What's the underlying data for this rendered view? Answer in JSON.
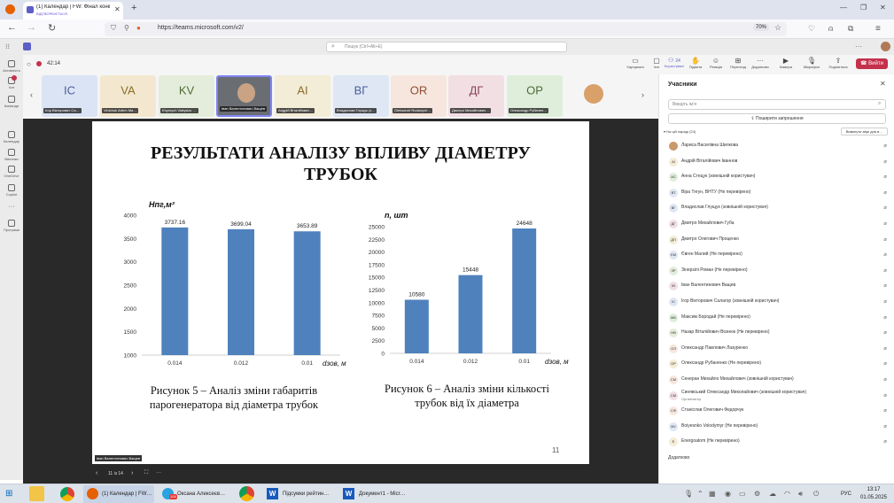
{
  "browser": {
    "tab_title": "(1) Календар | FW: Фінал конк",
    "tab_sub": "ВІДТВОРЮЄТЬСЯ",
    "url": "https://teams.microsoft.com/v2/",
    "zoom": "70%",
    "new_tab": "+"
  },
  "teams": {
    "search_placeholder": "Пошук (Ctrl+Alt+E)",
    "rail": [
      {
        "label": "Активність"
      },
      {
        "label": "Чат"
      },
      {
        "label": "Команди"
      },
      {
        "label": "Календар"
      },
      {
        "label": "Виклики"
      },
      {
        "label": "OneDrive"
      },
      {
        "label": "Copilot"
      },
      {
        "label": "Програми"
      }
    ],
    "timer": "42:14",
    "toolbar": [
      {
        "label": "Чат",
        "icon": "chat-icon"
      },
      {
        "label": "Користувачі",
        "icon": "people-icon",
        "count": "24"
      },
      {
        "label": "Підняти",
        "icon": "raise-hand-icon"
      },
      {
        "label": "Реакція",
        "icon": "react-icon"
      },
      {
        "label": "Перегляд",
        "icon": "view-icon"
      },
      {
        "label": "Додатково",
        "icon": "more-icon"
      }
    ],
    "toolbar_extra": [
      {
        "label": "Камера",
        "icon": "camera-icon"
      },
      {
        "label": "Мікрофон",
        "icon": "mic-icon"
      },
      {
        "label": "Поділитися",
        "icon": "share-icon"
      }
    ],
    "leave_button": "Вийти",
    "share_left_label": "Харчувати"
  },
  "tiles": [
    {
      "initials": "ІС",
      "name": "Ігор Вікторович Са…",
      "color": "#dbe4f5",
      "text": "#4a5d9a"
    },
    {
      "initials": "VA",
      "name": "Vinichuk Artem Ma…",
      "color": "#f3e8cf",
      "text": "#8a6d2a"
    },
    {
      "initials": "KV",
      "name": "Khymych Viatyslav …",
      "color": "#e4eddb",
      "text": "#4f6b38"
    },
    {
      "initials": "",
      "name": "Іван Валентинович Ващев",
      "color": "#6a6e73",
      "text": "#fff"
    },
    {
      "initials": "AI",
      "name": "Андрій Віталійович…",
      "color": "#f3ecd6",
      "text": "#8a6d2a"
    },
    {
      "initials": "ВГ",
      "name": "Владислав Глущук (з…",
      "color": "#dfe7f4",
      "text": "#4a5d9a"
    },
    {
      "initials": "OR",
      "name": "Oleksandr Rudanych…",
      "color": "#f6e6de",
      "text": "#8e4f35"
    },
    {
      "initials": "ДГ",
      "name": "Дмитро Михайлович…",
      "color": "#f1dfe4",
      "text": "#8a3f55"
    },
    {
      "initials": "OP",
      "name": "Олександр Рубанен…",
      "color": "#dfeedb",
      "text": "#4f6b38"
    },
    {
      "initials": "",
      "name": "",
      "color": "#f5f5f5",
      "text": "#fff"
    }
  ],
  "slide": {
    "title_line1": "РЕЗУЛЬТАТИ АНАЛІЗУ ВПЛИВУ ДІАМЕТРУ",
    "title_line2": "ТРУБОК",
    "caption1_line1": "Рисунок 5 – Аналіз зміни габаритів",
    "caption1_line2": "парогенератора від діаметра трубок",
    "caption2_line1": "Рисунок 6 – Аналіз зміни кількості",
    "caption2_line2": "трубок від їх діаметра",
    "page_number": "11",
    "presenter_label": "Іван Валентинович Ващев"
  },
  "chart_data": [
    {
      "type": "bar",
      "ylabel_html": "H",
      "ylabel": "Hпг,м²",
      "xlabel": "dзов, м",
      "categories": [
        "0.014",
        "0.012",
        "0.01"
      ],
      "values": [
        3737.16,
        3699.04,
        3653.89
      ],
      "data_labels": [
        "3737.16",
        "3699.04",
        "3653.89"
      ],
      "ylim": [
        1000,
        4000
      ],
      "yticks": [
        "1000",
        "1500",
        "2000",
        "2500",
        "3000",
        "3500",
        "4000"
      ],
      "color": "#4f81bd"
    },
    {
      "type": "bar",
      "ylabel": "n, шт",
      "xlabel": "dзов, м",
      "categories": [
        "0.014",
        "0.012",
        "0.01"
      ],
      "values": [
        10580,
        15448,
        24648
      ],
      "data_labels": [
        "10580",
        "15448",
        "24648"
      ],
      "ylim": [
        0,
        25000
      ],
      "yticks": [
        "0",
        "2500",
        "5000",
        "7500",
        "10000",
        "12500",
        "15000",
        "17500",
        "20000",
        "22500",
        "25000"
      ],
      "color": "#4f81bd"
    }
  ],
  "slide_nav": {
    "counter": "11 із 14"
  },
  "panel": {
    "title": "Учасники",
    "invite_placeholder": "Введіть ім'я",
    "share_invite": "Поширити запрошення",
    "in_meeting": "На цій нараді (24)",
    "mute_all": "Вимкнути звук для в…",
    "add_more": "Додатково",
    "people": [
      {
        "name": "Лариса Василівна Шилкова",
        "initials": "",
        "color": "#c9986b"
      },
      {
        "name": "Андрій Віталійович Іваннов",
        "initials": "AI",
        "color": "#f3ecd6"
      },
      {
        "name": "Анна Стецук (зовнішній користувач)",
        "initials": "АС",
        "color": "#dfeedb"
      },
      {
        "name": "Віра Тягун, ВНТУ (Не перевірено)",
        "initials": "ВТ",
        "color": "#dfe7f4"
      },
      {
        "name": "Владислав Глущук (зовнішній користувач)",
        "initials": "ВГ",
        "color": "#dfe7f4"
      },
      {
        "name": "Дмитро Михайлович Губа",
        "initials": "ДГ",
        "color": "#f1dfe4"
      },
      {
        "name": "Дмитро Олегович Проценко",
        "initials": "ДП",
        "color": "#f3ecd6"
      },
      {
        "name": "Євген Малий (Не перевірено)",
        "initials": "ЄМ",
        "color": "#dfe7f4"
      },
      {
        "name": "Зінерзілі Роман (Не перевірено)",
        "initials": "ЗР",
        "color": "#e4eddb"
      },
      {
        "name": "Іван Валентинович Ващев",
        "initials": "ІВ",
        "color": "#f1dfe4"
      },
      {
        "name": "Ігор Вікторович Салагор (зовнішній користувач)",
        "initials": "ІС",
        "color": "#dfe7f4"
      },
      {
        "name": "Максим Бородай (Не перевірено)",
        "initials": "МБ",
        "color": "#dfeedb"
      },
      {
        "name": "Назар Віталійович Вознюк (Не перевірено)",
        "initials": "НВ",
        "color": "#e4eddb"
      },
      {
        "name": "Олександр Павлович Лазуренко",
        "initials": "ОЛ",
        "color": "#f6e6de"
      },
      {
        "name": "Олександр Рубаненко (Не перевірено)",
        "initials": "ОР",
        "color": "#f3ecd6"
      },
      {
        "name": "Сенеран Михайло Михайлович (зовнішній користувач)",
        "initials": "СМ",
        "color": "#f6e6de"
      },
      {
        "name": "Синявський Олександр Миколайович (зовнішній користувач)",
        "initials": "СМ",
        "color": "#f1dfe4",
        "sub": "Організатор"
      },
      {
        "name": "Станіслав Олегович Федорчук",
        "initials": "СФ",
        "color": "#f6e6de"
      },
      {
        "name": "Boiyesnko Volodymyr (Не перевірено)",
        "initials": "BV",
        "color": "#dfe7f4"
      },
      {
        "name": "Energoatom (Не перевірено)",
        "initials": "E",
        "color": "#f3ecd6"
      }
    ]
  },
  "taskbar": {
    "firefox_label": "(1) Календар | FW…",
    "telegram_label": "Оксана Алексеєв…",
    "word1_label": "Підсумки рейтин…",
    "word2_label": "Документ1 - Micr…",
    "lang": "РУС",
    "time": "13:17",
    "date": "01.05.2025",
    "telegram_badge": "104"
  }
}
